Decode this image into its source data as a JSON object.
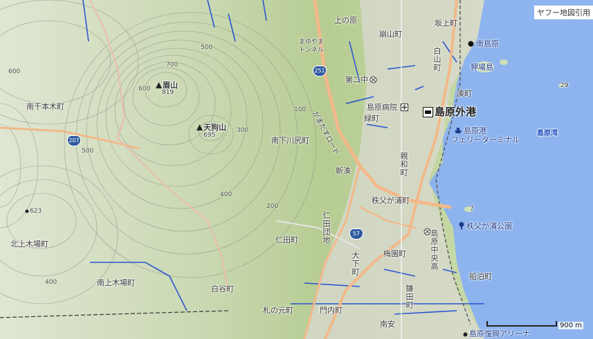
{
  "map": {
    "attribution": "ヤフー地図引用",
    "scale_label": "900 m",
    "colors": {
      "sea": "#8db4ee",
      "land_low": "#cfe0b8",
      "land_high": "#a8c08a",
      "road": "#f1b98a",
      "water": "#2a55d0"
    },
    "labels": {
      "uenohara": "上の原",
      "kuzureyama": "崩山町",
      "sakaue": "坂上町",
      "minamishimabara": "南島原",
      "shirayama": "白山町",
      "mayuyama_tunnel_1": "まゆやま",
      "mayuyama_tunnel_2": "トンネル",
      "tsukumo": "狎場島",
      "daini_chu": "第二中",
      "minato": "湊町",
      "tenmanzan": "眉山",
      "tenmanzan_alt": "819",
      "minamisenbongi": "南千本木町",
      "shimabara_hospital": "島原病院",
      "midori": "緑町",
      "shimabara_gaiko": "島原外港",
      "tengu": "天狗山",
      "tengu_alt": "695",
      "shimabara_port_1": "島原港",
      "ferry_terminal": "フェリーターミナル",
      "shimabara_bay": "島原湾",
      "minamishimokawajiri": "南下川尻町",
      "shinminato": "新湊",
      "oyawa": "親和町",
      "ganmado_road": "がまだすロード",
      "chichibugaura": "秩父が浦町",
      "chichibugaura_park": "秩父が浦公園",
      "peak_623": "623",
      "kitakamikiba": "北上木場町",
      "nita_danchi": "仁田団地",
      "nita": "仁田町",
      "ohshimo": "大下町",
      "baien": "梅園町",
      "shimabara_chuo": "島原中央高",
      "funatomari": "船泊町",
      "minamikamikiba": "南上木場町",
      "shiratani": "白谷町",
      "kamata": "鎌田町",
      "fudanomoto": "札の元町",
      "monnai": "門内町",
      "minamiyasu": "南安",
      "fukko_arena": "島原復興アリーナ",
      "isle_29": "29",
      "isle_7": "7",
      "route_251": "251",
      "route_207": "207",
      "route_57": "57",
      "c700": "700",
      "c600": "600",
      "c500a": "500",
      "c500b": "500",
      "c600b": "600",
      "c400a": "400",
      "c400b": "400",
      "c300": "300",
      "c200": "200",
      "c100": "100"
    }
  }
}
